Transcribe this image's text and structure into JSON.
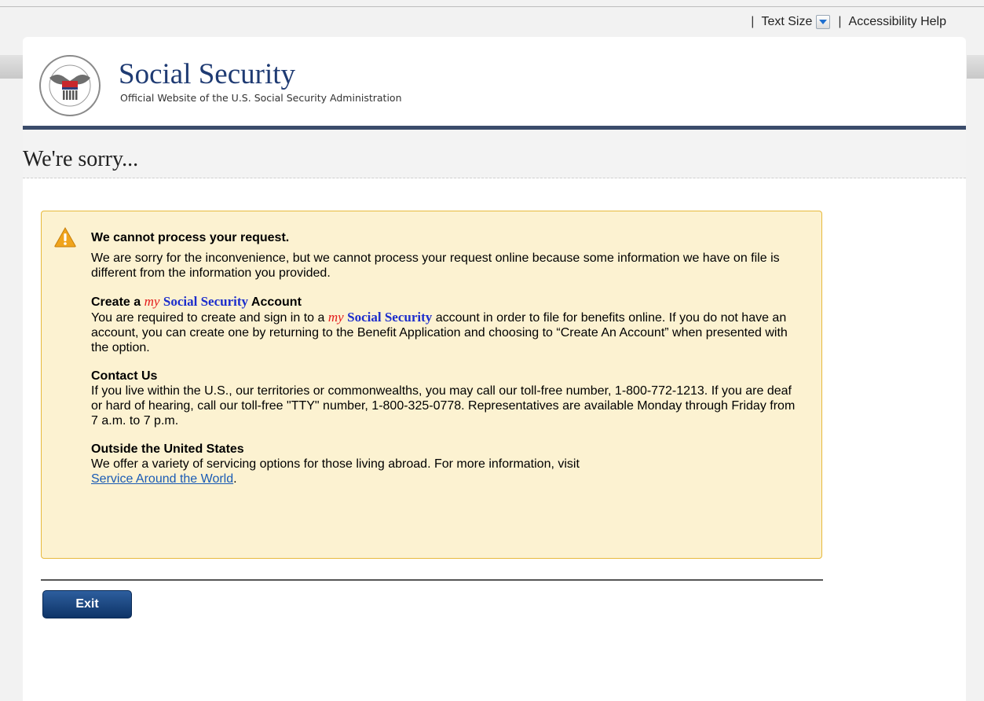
{
  "utility": {
    "separator": "|",
    "text_size_label": "Text Size",
    "accessibility_label": "Accessibility Help"
  },
  "header": {
    "title": "Social Security",
    "subtitle": "Official Website of the U.S. Social Security Administration",
    "logo_icon": "ssa-seal-icon"
  },
  "page": {
    "title": "We're sorry..."
  },
  "alert": {
    "icon": "warning-icon",
    "heading": "We cannot process your request.",
    "intro": "We are sorry for the inconvenience, but we cannot process your request online because some information we have on file is different from the information you provided.",
    "account": {
      "title_prefix": "Create a",
      "my": "my",
      "ss": "Social Security",
      "title_suffix": "Account",
      "text_before": "You are required to create and sign in to a",
      "text_after": "account in order to file for benefits online.  If you do not have an account, you can create one by returning to the Benefit Application and choosing to “Create An Account” when presented with the option."
    },
    "contact": {
      "title": "Contact Us",
      "text": "If you live within the U.S., our territories or commonwealths, you may call our toll-free number, 1-800-772-1213. If you are deaf or hard of hearing, call our toll-free \"TTY\" number, 1-800-325-0778. Representatives are available Monday through Friday from 7 a.m. to 7 p.m."
    },
    "outside": {
      "title": "Outside the United States",
      "text": "We offer a variety of servicing options for those living abroad. For more information, visit",
      "link": "Service Around the World",
      "period": "."
    }
  },
  "actions": {
    "exit_label": "Exit"
  },
  "colors": {
    "brand_navy": "#1f3b73",
    "alert_bg": "#fcf2d1",
    "alert_border": "#e7b93c",
    "link": "#1a5bb5"
  }
}
